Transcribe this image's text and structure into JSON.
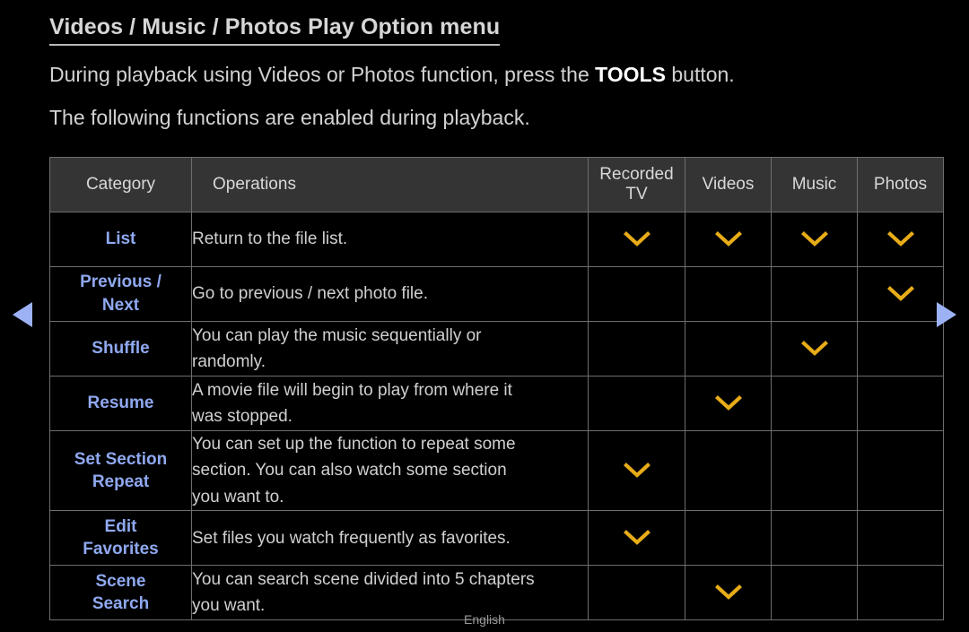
{
  "page": {
    "title": "Videos / Music / Photos Play Option menu",
    "intro_line_1_before": "During playback using Videos or Photos function, press the ",
    "intro_line_1_bold": "TOOLS",
    "intro_line_1_after": " button.",
    "intro_line_2": "The following functions are enabled during playback.",
    "footer_language": "English"
  },
  "nav": {
    "prev_label": "previous-page-arrow",
    "next_label": "next-page-arrow"
  },
  "colors": {
    "background": "#000000",
    "header_background": "#343434",
    "grid_line": "#6e6e6e",
    "body_text": "#d0d0d0",
    "category_text": "#8fa8f0",
    "mark_amber": "#e8ac19",
    "arrow_blue": "#9db2f5"
  },
  "table": {
    "headers": {
      "category": "Category",
      "operations": "Operations",
      "recorded_tv": "Recorded TV",
      "videos": "Videos",
      "music": "Music",
      "photos": "Photos"
    },
    "mark_icon": "chevron-down-icon",
    "rows": [
      {
        "category": "List",
        "category_lines": [
          "List"
        ],
        "operation": "Return to the file list.",
        "operation_lines": [
          "Return to the file list."
        ],
        "recorded_tv": true,
        "videos": true,
        "music": true,
        "photos": true
      },
      {
        "category": "Previous / Next",
        "category_lines": [
          "Previous /",
          "Next"
        ],
        "operation": "Go to previous / next photo file.",
        "operation_lines": [
          "Go to previous / next photo file."
        ],
        "recorded_tv": false,
        "videos": false,
        "music": false,
        "photos": true
      },
      {
        "category": "Shuffle",
        "category_lines": [
          "Shuffle"
        ],
        "operation": "You can play the music sequentially or randomly.",
        "operation_lines": [
          "You can play the music sequentially or",
          "randomly."
        ],
        "recorded_tv": false,
        "videos": false,
        "music": true,
        "photos": false
      },
      {
        "category": "Resume",
        "category_lines": [
          "Resume"
        ],
        "operation": "A movie file will begin to play from where it was stopped.",
        "operation_lines": [
          "A movie file will begin to play from where it",
          "was stopped."
        ],
        "recorded_tv": false,
        "videos": true,
        "music": false,
        "photos": false
      },
      {
        "category": "Set Section Repeat",
        "category_lines": [
          "Set Section",
          "Repeat"
        ],
        "operation": "You can set up the function to repeat some section. You can also watch some section you want to.",
        "operation_lines": [
          "You can set up the function to repeat some",
          "section. You can also watch some section",
          "you want to."
        ],
        "recorded_tv": true,
        "videos": false,
        "music": false,
        "photos": false
      },
      {
        "category": "Edit Favorites",
        "category_lines": [
          "Edit",
          "Favorites"
        ],
        "operation": "Set files you watch frequently as favorites.",
        "operation_lines": [
          "Set files you watch frequently as favorites."
        ],
        "recorded_tv": true,
        "videos": false,
        "music": false,
        "photos": false
      },
      {
        "category": "Scene Search",
        "category_lines": [
          "Scene",
          "Search"
        ],
        "operation": "You can search scene divided into 5 chapters you want.",
        "operation_lines": [
          "You can search scene divided into 5 chapters",
          "you want."
        ],
        "recorded_tv": false,
        "videos": true,
        "music": false,
        "photos": false
      }
    ]
  }
}
